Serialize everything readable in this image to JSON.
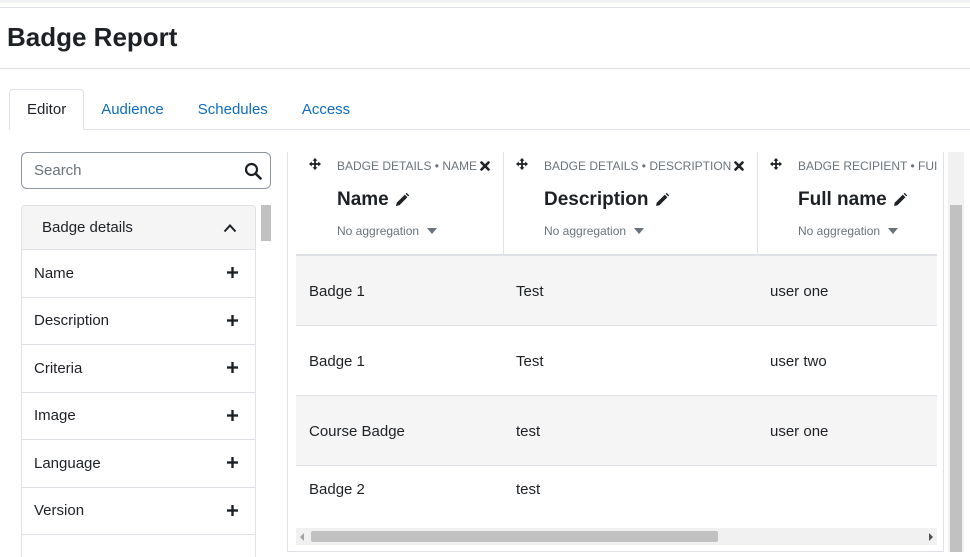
{
  "page": {
    "title": "Badge Report"
  },
  "tabs": [
    {
      "label": "Editor",
      "active": true
    },
    {
      "label": "Audience",
      "active": false
    },
    {
      "label": "Schedules",
      "active": false
    },
    {
      "label": "Access",
      "active": false
    }
  ],
  "sidebar": {
    "search_placeholder": "Search",
    "section_title": "Badge details",
    "items": [
      {
        "label": "Name"
      },
      {
        "label": "Description"
      },
      {
        "label": "Criteria"
      },
      {
        "label": "Image"
      },
      {
        "label": "Language"
      },
      {
        "label": "Version"
      }
    ]
  },
  "report": {
    "columns": [
      {
        "crumb": "BADGE DETAILS • NAME",
        "title": "Name",
        "aggregation": "No aggregation"
      },
      {
        "crumb": "BADGE DETAILS • DESCRIPTION",
        "title": "Description",
        "aggregation": "No aggregation"
      },
      {
        "crumb": "BADGE RECIPIENT • FUI",
        "title": "Full name",
        "aggregation": "No aggregation"
      }
    ],
    "rows": [
      {
        "cells": [
          "Badge 1",
          "Test",
          "user one"
        ]
      },
      {
        "cells": [
          "Badge 1",
          "Test",
          "user two"
        ]
      },
      {
        "cells": [
          "Course Badge",
          "test",
          "user one"
        ]
      },
      {
        "cells": [
          "Badge 2",
          "test",
          ""
        ]
      }
    ]
  },
  "colors": {
    "link": "#0f6cbf",
    "text": "#1d2125",
    "muted": "#6a737b",
    "border": "#dee2e6",
    "stripe": "#f5f5f5"
  }
}
